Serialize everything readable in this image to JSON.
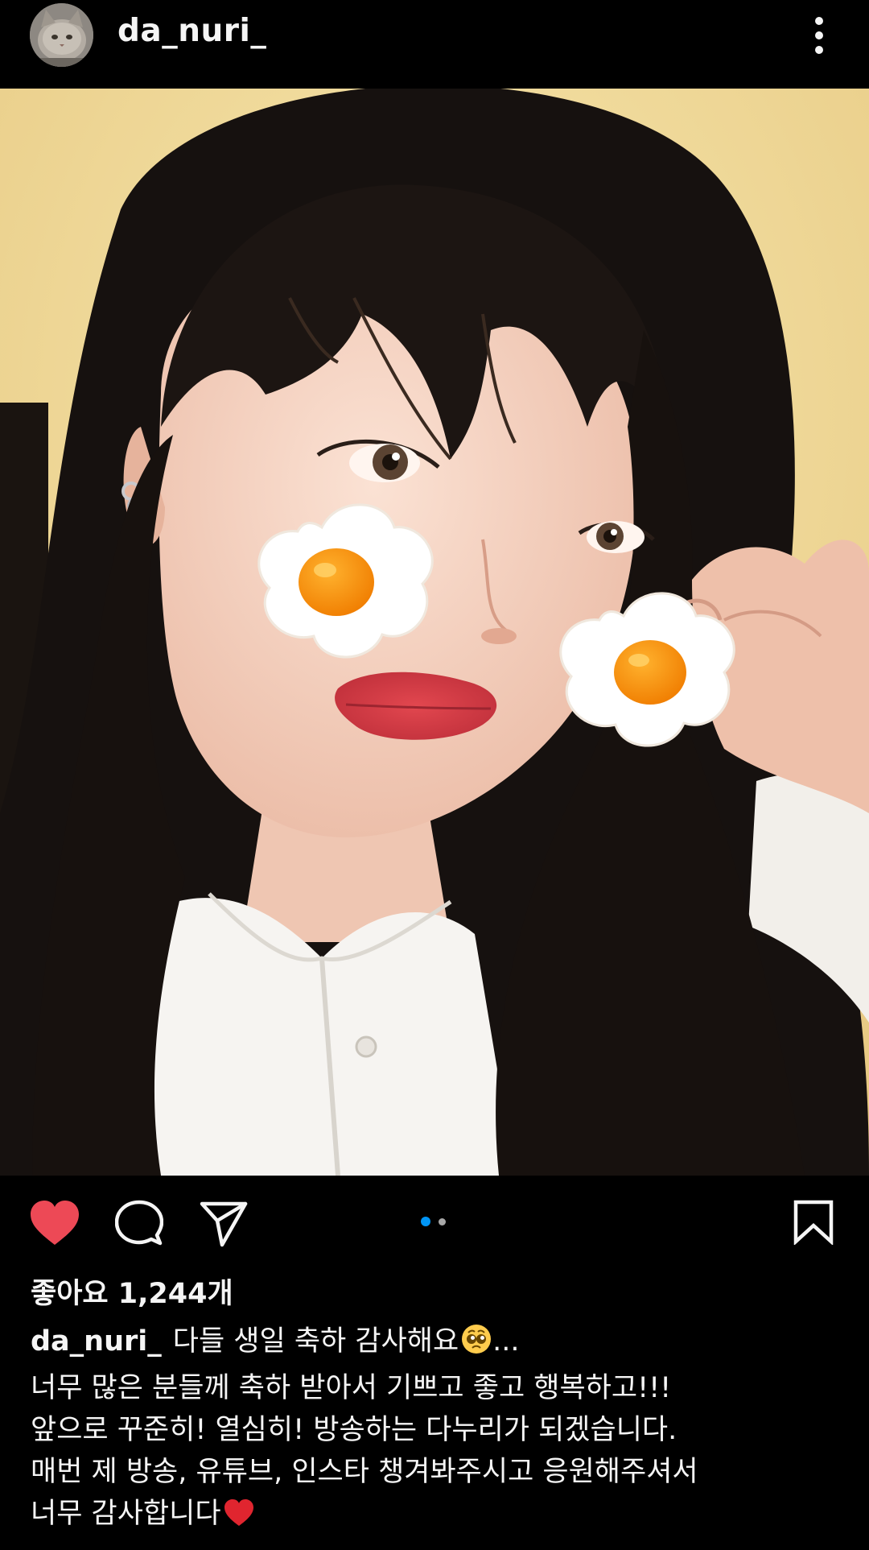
{
  "post": {
    "username": "da_nuri_",
    "likes_text": "좋아요 1,244개",
    "carousel": {
      "total": 2,
      "active_index": 0
    },
    "caption": {
      "username": "da_nuri_",
      "line1": "다들 생일 축하 감사해요",
      "line1_suffix": "...",
      "line2": "너무 많은 분들께 축하 받아서 기쁘고 좋고 행복하고!!!",
      "line3": "앞으로 꾸준히! 열심히! 방송하는 다누리가 되겠습니다.",
      "line4": "매번 제 방송, 유튜브, 인스타 챙겨봐주시고 응원해주셔서",
      "line5": "너무 감사합니다"
    }
  },
  "icons": {
    "avatar": "cat-avatar",
    "more": "more-vertical-icon",
    "like": "heart-filled-icon",
    "comment": "comment-bubble-icon",
    "share": "paper-plane-icon",
    "save": "bookmark-icon",
    "emoji1": "pleading-face-emoji",
    "emoji2": "red-heart-emoji"
  },
  "colors": {
    "background": "#000000",
    "text": "#f5f5f5",
    "like_red": "#ed4956",
    "carousel_active": "#0095f6",
    "carousel_inactive": "#a8a8a8"
  }
}
